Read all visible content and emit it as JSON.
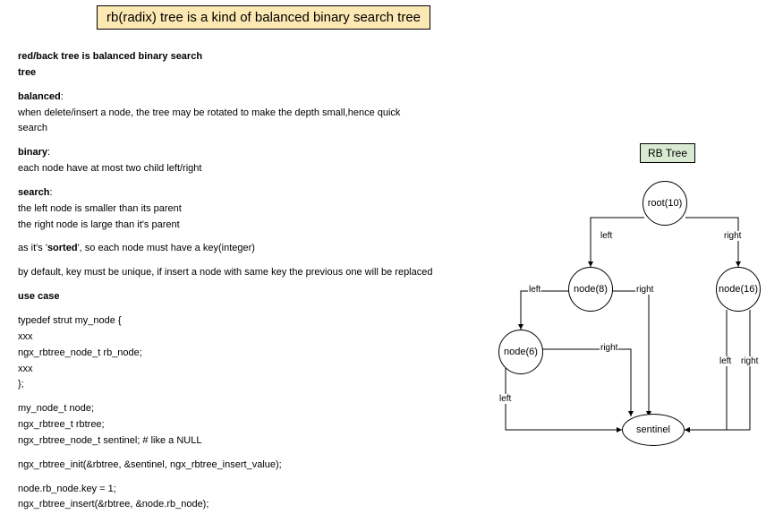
{
  "title": "rb(radix) tree is a kind of balanced binary search tree",
  "text": {
    "heading1": "red/back tree is balanced binary search",
    "heading1b": "tree",
    "balanced_label": "balanced",
    "balanced_desc1": "when delete/insert a node, the tree may be rotated to make the depth small,hence quick",
    "balanced_desc2": "search",
    "binary_label": "binary",
    "binary_desc": "each node have at most two child left/right",
    "search_label": "search",
    "search_desc1": "the left node is smaller than its parent",
    "search_desc2": "the right node is large than it's parent",
    "sorted_prefix": "as it's '",
    "sorted_word": "sorted",
    "sorted_suffix": "', so each node must have a key(integer)",
    "unique": "by default, key must be unique, if insert a node with same key the previous one will be replaced",
    "usecase": "use case",
    "code1": "typedef strut my_node {",
    "code2": "xxx",
    "code3": "ngx_rbtree_node_t rb_node;",
    "code4": "xxx",
    "code5": "};",
    "code6": "my_node_t node;",
    "code7": "ngx_rbtree_t rbtree;",
    "code8": "ngx_rbtree_node_t sentinel; # like a NULL",
    "code9": "ngx_rbtree_init(&rbtree, &sentinel, ngx_rbtree_insert_value);",
    "code10": "node.rb_node.key = 1;",
    "code11": "ngx_rbtree_insert(&rbtree, &node.rb_node);"
  },
  "diagram": {
    "label": "RB Tree",
    "root": "root(10)",
    "node8": "node(8)",
    "node16": "node(16)",
    "node6": "node(6)",
    "sentinel": "sentinel",
    "left": "left",
    "right": "right"
  },
  "chart_data": {
    "type": "tree",
    "title": "RB Tree",
    "nodes": [
      {
        "id": "root",
        "label": "root(10)",
        "key": 10
      },
      {
        "id": "n8",
        "label": "node(8)",
        "key": 8
      },
      {
        "id": "n16",
        "label": "node(16)",
        "key": 16
      },
      {
        "id": "n6",
        "label": "node(6)",
        "key": 6
      },
      {
        "id": "sentinel",
        "label": "sentinel"
      }
    ],
    "edges": [
      {
        "from": "root",
        "to": "n8",
        "label": "left"
      },
      {
        "from": "root",
        "to": "n16",
        "label": "right"
      },
      {
        "from": "n8",
        "to": "n6",
        "label": "left"
      },
      {
        "from": "n8",
        "to": "sentinel",
        "label": "right"
      },
      {
        "from": "n16",
        "to": "sentinel",
        "label": "left"
      },
      {
        "from": "n16",
        "to": "sentinel",
        "label": "right"
      },
      {
        "from": "n6",
        "to": "sentinel",
        "label": "left"
      },
      {
        "from": "n6",
        "to": "sentinel",
        "label": "right"
      }
    ]
  }
}
